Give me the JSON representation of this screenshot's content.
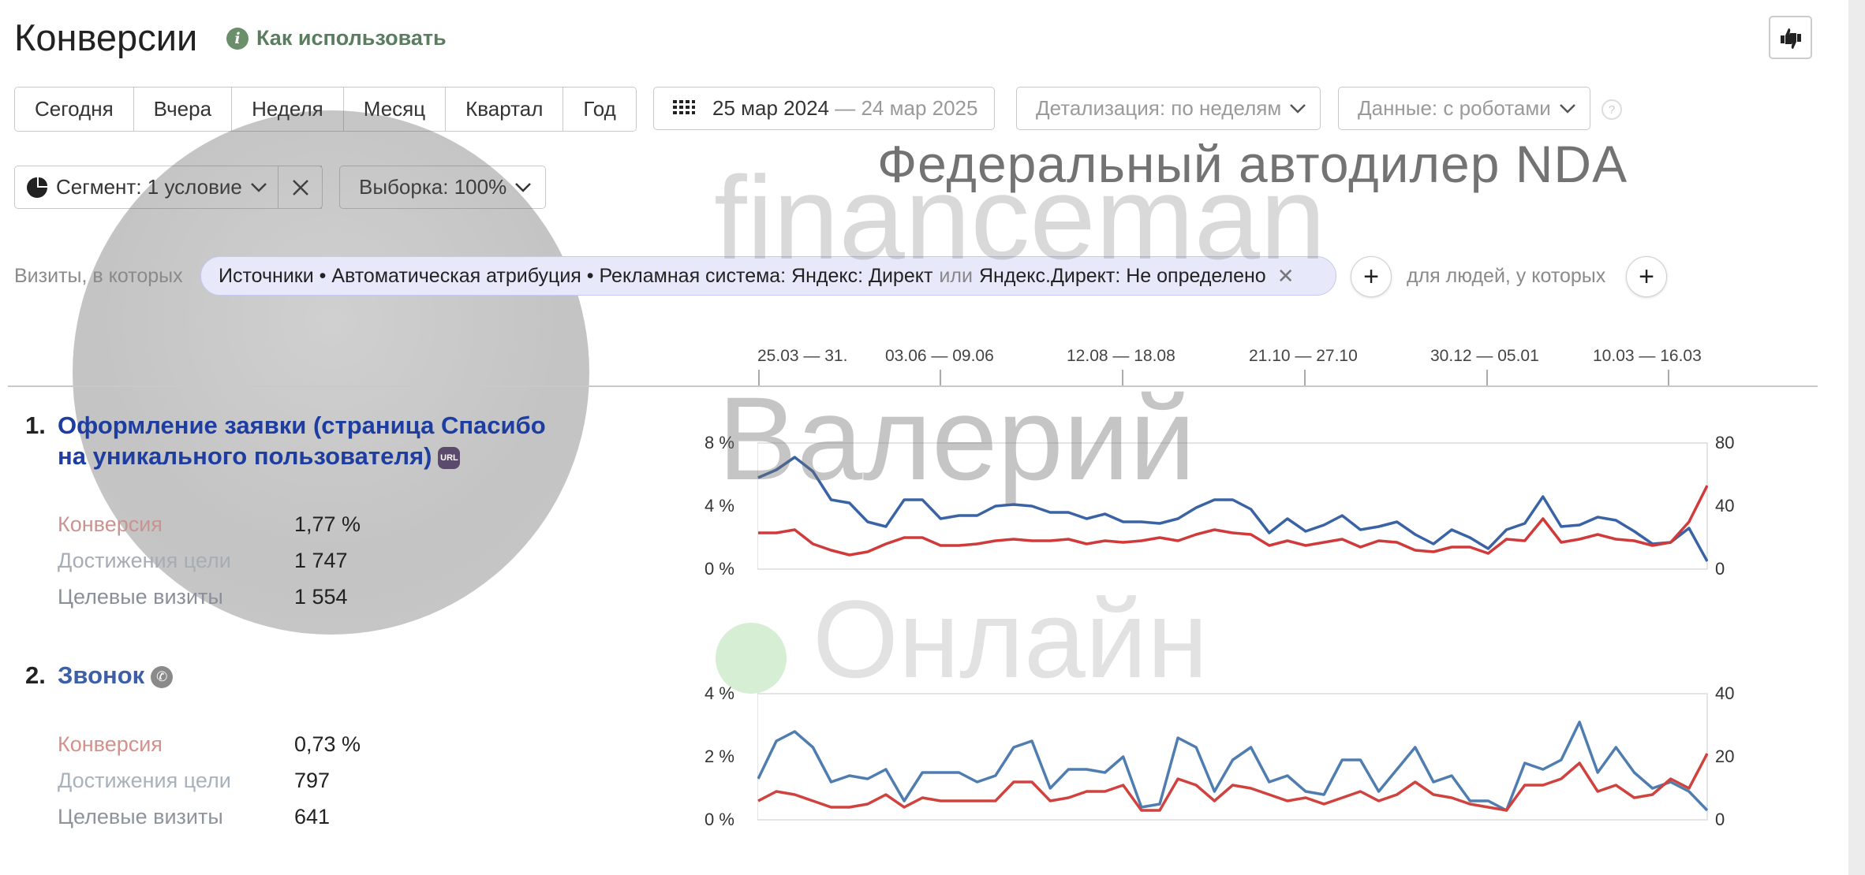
{
  "header": {
    "title": "Конверсии",
    "info_icon": "i",
    "howto_label": "Как использовать",
    "feedback_icon": "thumbs-up-down-icon"
  },
  "toolbar": {
    "periods": [
      "Сегодня",
      "Вчера",
      "Неделя",
      "Месяц",
      "Квартал",
      "Год"
    ],
    "date_from": "25 мар 2024",
    "date_to": "— 24 мар 2025",
    "detail": "Детализация: по неделям",
    "data": "Данные: с роботами",
    "help": "?"
  },
  "segment": {
    "label": "Сегмент: 1 условие",
    "sample": "Выборка: 100%"
  },
  "filter": {
    "visits_label": "Визиты, в которых",
    "chip_text": "Источники • Автоматическая атрибуция • Рекламная система: Яндекс: Директ",
    "or_word": "или",
    "chip_text2": "Яндекс.Директ: Не определено",
    "people_label": "для людей, у которых",
    "plus": "+"
  },
  "timeline": {
    "ticks": [
      "25.03 — 31.",
      "03.06 — 09.06",
      "12.08 — 18.08",
      "21.10 — 27.10",
      "30.12 — 05.01",
      "10.03 — 16.03"
    ]
  },
  "goals": [
    {
      "number": "1.",
      "title": "Оформление заявки (страница Спасибо на уникального пользователя)",
      "badge": "URL",
      "metrics": [
        {
          "label": "Конверсия",
          "value": "1,77 %",
          "color": "#c99490"
        },
        {
          "label": "Достижения цели",
          "value": "1 747",
          "color": "#a6adb5"
        },
        {
          "label": "Целевые визиты",
          "value": "1 554",
          "color": "#8a8f99"
        }
      ]
    },
    {
      "number": "2.",
      "title": "Звонок",
      "badge": "phone-icon",
      "metrics": [
        {
          "label": "Конверсия",
          "value": "0,73 %",
          "color": "#d4908a"
        },
        {
          "label": "Достижения цели",
          "value": "797",
          "color": "#a9b1bb"
        },
        {
          "label": "Целевые визиты",
          "value": "641",
          "color": "#8f939c"
        }
      ]
    }
  ],
  "chart_data": [
    {
      "type": "line",
      "left_axis": [
        "8 %",
        "4 %",
        "0 %"
      ],
      "right_axis": [
        "80",
        "40",
        "0"
      ],
      "ylim_left": [
        0,
        8
      ],
      "ylim_right": [
        0,
        80
      ],
      "series": [
        {
          "axis": "left",
          "color": "#3a63a5",
          "values": [
            5.8,
            6.3,
            7.1,
            6.2,
            4.4,
            4.2,
            3.0,
            2.7,
            4.4,
            4.4,
            3.2,
            3.4,
            3.4,
            4.0,
            4.1,
            4.0,
            3.6,
            3.6,
            3.2,
            3.5,
            3.0,
            3.0,
            2.9,
            3.2,
            3.9,
            4.4,
            4.4,
            3.8,
            2.3,
            3.2,
            2.4,
            2.8,
            3.4,
            2.5,
            2.7,
            3.0,
            2.2,
            1.6,
            2.5,
            2.0,
            1.3,
            2.5,
            2.9,
            4.6,
            2.7,
            2.8,
            3.3,
            3.1,
            2.4,
            1.6,
            1.7,
            2.6,
            0.5
          ]
        },
        {
          "axis": "right",
          "color": "#d03a3a",
          "values": [
            23,
            23,
            25,
            16,
            12,
            9,
            11,
            16,
            20,
            20,
            15,
            15,
            16,
            18,
            19,
            18,
            18,
            19,
            16,
            18,
            17,
            18,
            20,
            18,
            22,
            25,
            23,
            22,
            15,
            18,
            15,
            17,
            19,
            14,
            18,
            17,
            12,
            11,
            14,
            14,
            10,
            19,
            18,
            32,
            17,
            19,
            22,
            19,
            18,
            15,
            17,
            30,
            53
          ]
        }
      ]
    },
    {
      "type": "line",
      "left_axis": [
        "4 %",
        "2 %",
        "0 %"
      ],
      "right_axis": [
        "40",
        "20",
        "0"
      ],
      "ylim_left": [
        0,
        4
      ],
      "ylim_right": [
        0,
        40
      ],
      "series": [
        {
          "axis": "left",
          "color": "#4f7db0",
          "values": [
            1.3,
            2.5,
            2.8,
            2.3,
            1.2,
            1.4,
            1.3,
            1.6,
            0.6,
            1.5,
            1.5,
            1.5,
            1.2,
            1.4,
            2.3,
            2.5,
            1.0,
            1.6,
            1.6,
            1.5,
            2.0,
            0.4,
            0.5,
            2.6,
            2.3,
            0.9,
            1.9,
            2.3,
            1.2,
            1.4,
            0.9,
            0.8,
            1.9,
            1.9,
            0.9,
            1.6,
            2.3,
            1.2,
            1.4,
            0.6,
            0.6,
            0.3,
            1.8,
            1.6,
            1.9,
            3.1,
            1.5,
            2.3,
            1.5,
            1.0,
            1.2,
            0.9,
            0.3
          ]
        },
        {
          "axis": "right",
          "color": "#d0423e",
          "values": [
            6,
            9,
            8,
            6,
            4,
            4,
            5,
            8,
            4,
            7,
            6,
            6,
            6,
            6,
            12,
            12,
            6,
            7,
            9,
            9,
            11,
            3,
            3,
            13,
            11,
            6,
            11,
            10,
            8,
            6,
            7,
            5,
            7,
            9,
            6,
            8,
            12,
            8,
            7,
            5,
            4,
            3,
            11,
            11,
            13,
            18,
            9,
            11,
            7,
            8,
            13,
            10,
            21
          ]
        }
      ]
    }
  ],
  "watermark": {
    "dealer": "Федеральный автодилер NDA",
    "brand": "financeman",
    "name": "Валерий",
    "online": "Онлайн"
  }
}
